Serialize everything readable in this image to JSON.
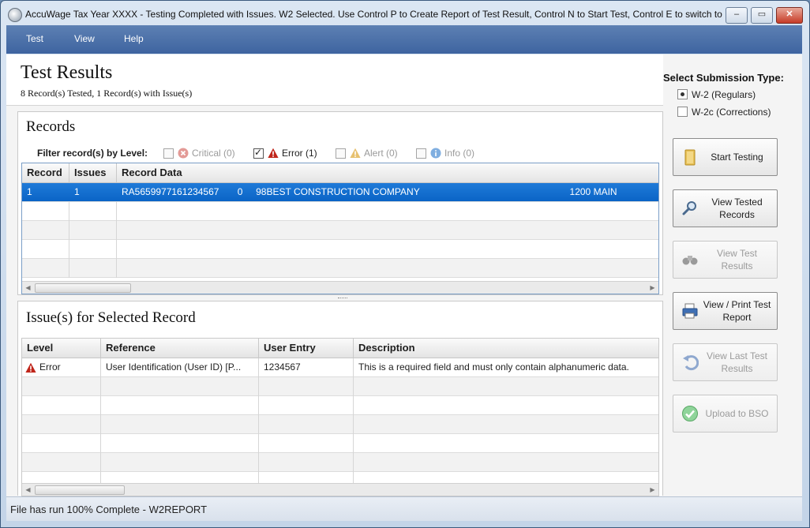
{
  "window": {
    "title": "AccuWage Tax Year XXXX - Testing Completed with Issues.  W2 Selected. Use Control P to Create Report of Test Result,  Control N to Start Test,  Control E to switch to ...",
    "controls": {
      "minimize": "‒",
      "maximize": "▭",
      "close": "✕"
    }
  },
  "menu": {
    "items": [
      "Test",
      "View",
      "Help"
    ]
  },
  "header": {
    "title": "Test Results",
    "subtitle": "8 Record(s) Tested, 1 Record(s) with Issue(s)"
  },
  "records": {
    "title": "Records",
    "filter": {
      "label": "Filter record(s) by Level:",
      "options": [
        {
          "label": "Critical (0)",
          "checked": false,
          "icon": "critical-icon",
          "enabled": false
        },
        {
          "label": "Error (1)",
          "checked": true,
          "icon": "error-icon",
          "enabled": true
        },
        {
          "label": "Alert (0)",
          "checked": false,
          "icon": "alert-icon",
          "enabled": false
        },
        {
          "label": "Info (0)",
          "checked": false,
          "icon": "info-icon",
          "enabled": false
        }
      ]
    },
    "columns": [
      "Record",
      "Issues",
      "Record Data"
    ],
    "rows": [
      {
        "record": "1",
        "issues": "1",
        "data": "RA5659977161234567       0     98BEST CONSTRUCTION COMPANY                                                         1200 MAIN"
      }
    ]
  },
  "issues": {
    "title": "Issue(s) for Selected Record",
    "columns": [
      "Level",
      "Reference",
      "User Entry",
      "Description"
    ],
    "rows": [
      {
        "level": "Error",
        "reference": "User Identification (User ID) [P...",
        "entry": "1234567",
        "description": "This is a required field and must only contain alphanumeric data."
      }
    ]
  },
  "sidebar": {
    "submission_label": "Select Submission Type:",
    "types": [
      {
        "label": "W-2 (Regulars)",
        "selected": true
      },
      {
        "label": "W-2c (Corrections)",
        "selected": false
      }
    ],
    "buttons": [
      {
        "label": "Start Testing",
        "enabled": true,
        "icon": "folder-icon"
      },
      {
        "label": "View Tested Records",
        "enabled": true,
        "icon": "magnifier-icon"
      },
      {
        "label": "View Test Results",
        "enabled": false,
        "icon": "binoculars-icon"
      },
      {
        "label": "View / Print Test Report",
        "enabled": true,
        "icon": "printer-icon"
      },
      {
        "label": "View Last Test Results",
        "enabled": false,
        "icon": "undo-arrow-icon"
      },
      {
        "label": "Upload to BSO",
        "enabled": false,
        "icon": "check-circle-icon"
      }
    ]
  },
  "status": {
    "text": "File has run 100% Complete - W2REPORT"
  },
  "colors": {
    "menubar": "#4a6fa8",
    "selection": "#0f6ccb",
    "error": "#c0251a"
  }
}
